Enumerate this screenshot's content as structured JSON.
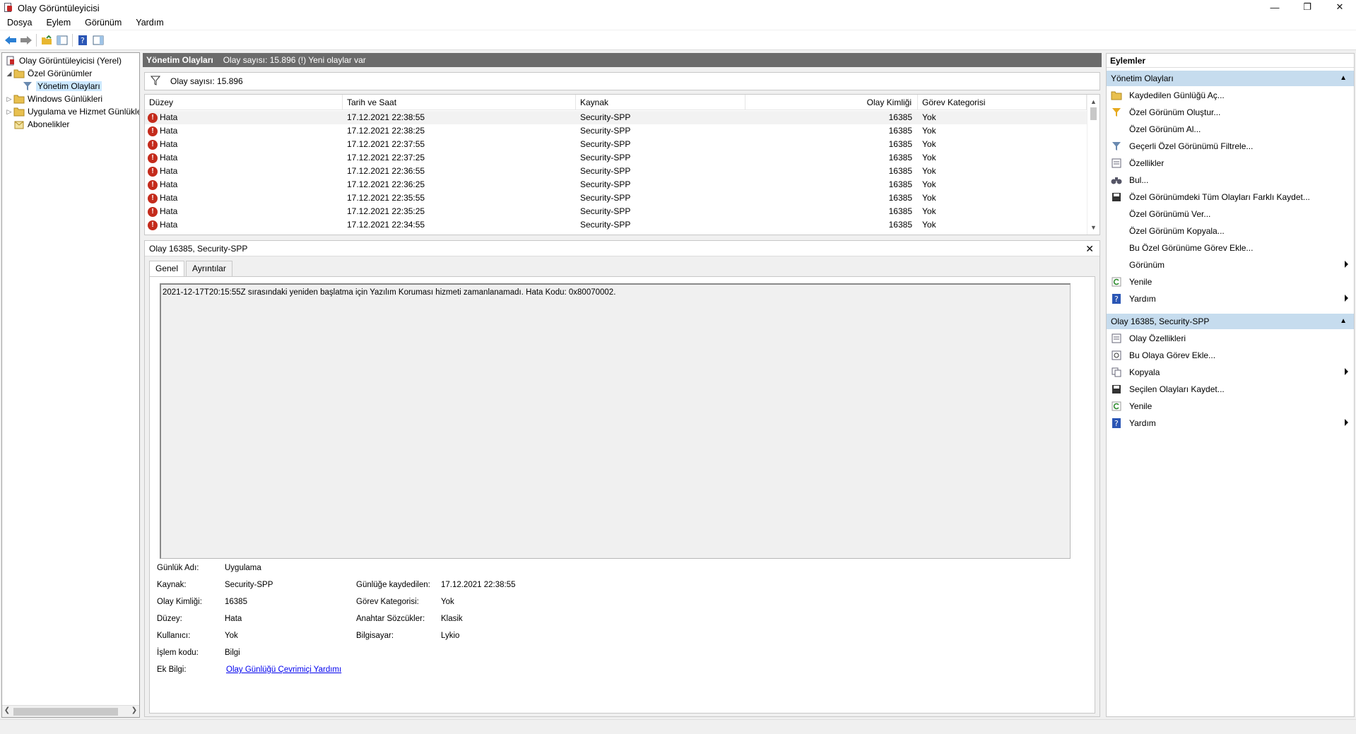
{
  "window": {
    "title": "Olay Görüntüleyicisi"
  },
  "menu": [
    "Dosya",
    "Eylem",
    "Görünüm",
    "Yardım"
  ],
  "tree": [
    {
      "label": "Olay Görüntüleyicisi (Yerel)"
    },
    {
      "label": "Özel Görünümler"
    },
    {
      "label": "Yönetim Olayları"
    },
    {
      "label": "Windows Günlükleri"
    },
    {
      "label": "Uygulama ve Hizmet Günlükleri"
    },
    {
      "label": "Abonelikler"
    }
  ],
  "header": {
    "title": "Yönetim Olayları",
    "info": "Olay sayısı: 15.896 (!) Yeni olaylar var"
  },
  "filter": {
    "count_text": "Olay sayısı: 15.896"
  },
  "grid": {
    "columns": [
      "Düzey",
      "Tarih ve Saat",
      "Kaynak",
      "Olay Kimliği",
      "Görev Kategorisi"
    ],
    "rows": [
      [
        "Hata",
        "17.12.2021 22:38:55",
        "Security-SPP",
        "16385",
        "Yok"
      ],
      [
        "Hata",
        "17.12.2021 22:38:25",
        "Security-SPP",
        "16385",
        "Yok"
      ],
      [
        "Hata",
        "17.12.2021 22:37:55",
        "Security-SPP",
        "16385",
        "Yok"
      ],
      [
        "Hata",
        "17.12.2021 22:37:25",
        "Security-SPP",
        "16385",
        "Yok"
      ],
      [
        "Hata",
        "17.12.2021 22:36:55",
        "Security-SPP",
        "16385",
        "Yok"
      ],
      [
        "Hata",
        "17.12.2021 22:36:25",
        "Security-SPP",
        "16385",
        "Yok"
      ],
      [
        "Hata",
        "17.12.2021 22:35:55",
        "Security-SPP",
        "16385",
        "Yok"
      ],
      [
        "Hata",
        "17.12.2021 22:35:25",
        "Security-SPP",
        "16385",
        "Yok"
      ],
      [
        "Hata",
        "17.12.2021 22:34:55",
        "Security-SPP",
        "16385",
        "Yok"
      ]
    ]
  },
  "detail": {
    "title": "Olay 16385, Security-SPP",
    "tabs": [
      "Genel",
      "Ayrıntılar"
    ],
    "message": "2021-12-17T20:15:55Z sırasındaki yeniden başlatma için Yazılım Koruması hizmeti zamanlanamadı. Hata Kodu: 0x80070002.",
    "props": {
      "log_name_label": "Günlük Adı:",
      "log_name": "Uygulama",
      "source_label": "Kaynak:",
      "source": "Security-SPP",
      "logged_label": "Günlüğe kaydedilen:",
      "logged": "17.12.2021 22:38:55",
      "event_id_label": "Olay Kimliği:",
      "event_id": "16385",
      "task_label": "Görev Kategorisi:",
      "task": "Yok",
      "level_label": "Düzey:",
      "level": "Hata",
      "keywords_label": "Anahtar Sözcükler:",
      "keywords": "Klasik",
      "user_label": "Kullanıcı:",
      "user": "Yok",
      "computer_label": "Bilgisayar:",
      "computer": "Lykio",
      "opcode_label": "İşlem kodu:",
      "opcode": "Bilgi",
      "more_label": "Ek Bilgi:",
      "more_link": "Olay Günlüğü Çevrimiçi Yardımı"
    }
  },
  "actions": {
    "title": "Eylemler",
    "section1": {
      "title": "Yönetim Olayları",
      "items": [
        "Kaydedilen Günlüğü Aç...",
        "Özel Görünüm Oluştur...",
        "Özel Görünüm Al...",
        "Geçerli Özel Görünümü Filtrele...",
        "Özellikler",
        "Bul...",
        "Özel Görünümdeki Tüm Olayları Farklı Kaydet...",
        "Özel Görünümü Ver...",
        "Özel Görünüm Kopyala...",
        "Bu Özel Görünüme Görev Ekle...",
        "Görünüm",
        "Yenile",
        "Yardım"
      ]
    },
    "section2": {
      "title": "Olay 16385, Security-SPP",
      "items": [
        "Olay Özellikleri",
        "Bu Olaya Görev Ekle...",
        "Kopyala",
        "Seçilen Olayları Kaydet...",
        "Yenile",
        "Yardım"
      ]
    }
  },
  "colors": {
    "accent": "#c6dcee",
    "header_bg": "#6b6b6b",
    "error": "#c42b1c",
    "selection": "#cce8ff"
  }
}
